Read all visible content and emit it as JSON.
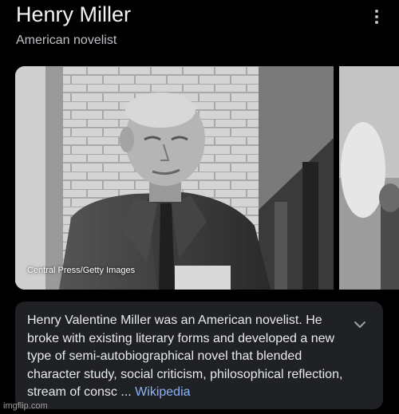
{
  "entity": {
    "name": "Henry Miller",
    "type": "American novelist"
  },
  "header": {
    "menu_icon": "more-vert-icon"
  },
  "images": {
    "main_credit": "Central Press/Getty Images"
  },
  "description": {
    "text": "Henry Valentine Miller was an American novelist. He broke with existing literary forms and developed a new type of semi-autobiographical novel that blended character study, social criticism, philosophical reflection, stream of consc",
    "ellipsis": " ... ",
    "source": "Wikipedia",
    "expand_icon": "chevron-down-icon"
  },
  "watermark": "imgflip.com",
  "colors": {
    "background": "#000000",
    "card": "#202124",
    "link": "#8ab4f8",
    "text": "#e8eaed",
    "secondary_text": "#bdc1c6"
  }
}
